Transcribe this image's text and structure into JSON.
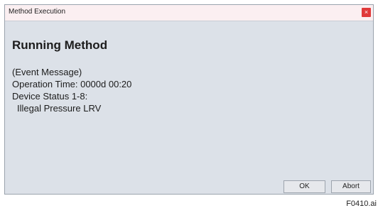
{
  "window": {
    "title": "Method Execution",
    "close_label": "×"
  },
  "content": {
    "heading": "Running Method",
    "lines": [
      "(Event Message)",
      "Operation Time: 0000d 00:20",
      "Device Status 1-8:",
      "Illegal Pressure LRV"
    ]
  },
  "buttons": {
    "ok_label": "OK",
    "abort_label": "Abort"
  },
  "figure": {
    "caption": "F0410.ai"
  },
  "colors": {
    "window_background": "#dce1e8",
    "titlebar_background": "#fbeff1",
    "close_button": "#e03a3a"
  },
  "icons": {
    "close": "close-icon"
  }
}
